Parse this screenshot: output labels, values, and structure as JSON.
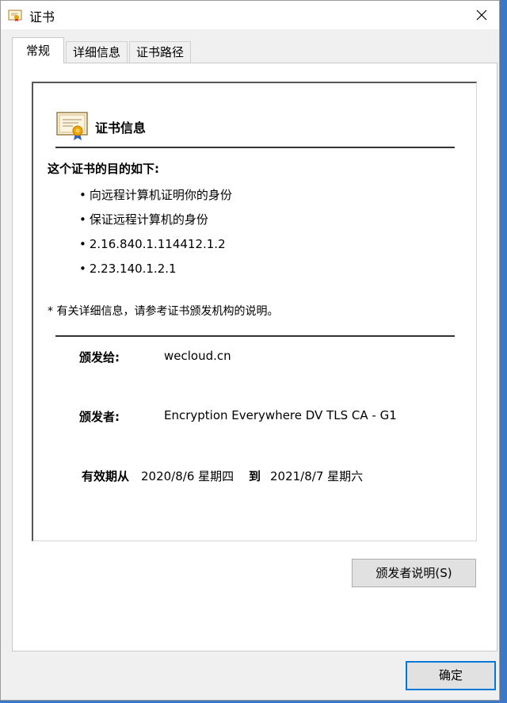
{
  "window": {
    "title": "证书"
  },
  "tabs": [
    {
      "label": "常规",
      "active": true
    },
    {
      "label": "详细信息",
      "active": false
    },
    {
      "label": "证书路径",
      "active": false
    }
  ],
  "general": {
    "heading": "证书信息",
    "purpose_title": "这个证书的目的如下:",
    "purposes": [
      "向远程计算机证明你的身份",
      "保证远程计算机的身份",
      "2.16.840.1.114412.1.2",
      "2.23.140.1.2.1"
    ],
    "note": "* 有关详细信息，请参考证书颁发机构的说明。",
    "issued_to_label": "颁发给:",
    "issued_to_value": "wecloud.cn",
    "issued_by_label": "颁发者:",
    "issued_by_value": "Encryption Everywhere DV TLS CA - G1",
    "validity_label": "有效期从",
    "valid_from": "2020/8/6 星期四",
    "to_label": "到",
    "valid_to": "2021/8/7 星期六"
  },
  "buttons": {
    "issuer_statement": "颁发者说明(S)",
    "ok": "确定"
  },
  "colors": {
    "ok_border": "#0078d7",
    "taskbar": "#3b78c8",
    "window_bg": "#f0f0f0"
  },
  "icons": {
    "title": "certificate-icon",
    "close": "close-icon",
    "heading": "certificate-icon"
  }
}
